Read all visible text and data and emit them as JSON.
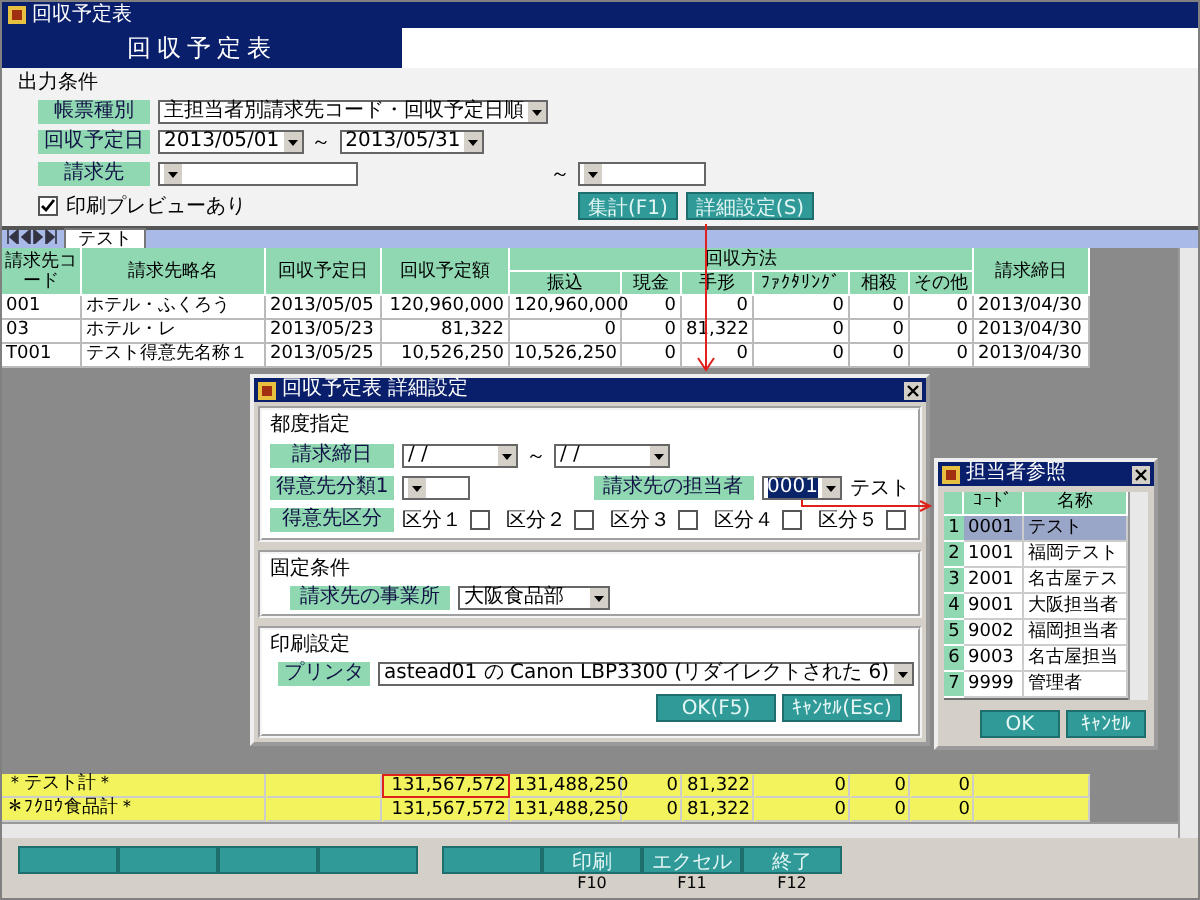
{
  "window": {
    "title": "回収予定表"
  },
  "header": {
    "title": "回収予定表"
  },
  "conditions": {
    "heading": "出力条件",
    "report_type": {
      "label": "帳票種別",
      "value": "主担当者別請求先コード・回収予定日順"
    },
    "due_date": {
      "label": "回収予定日",
      "from": "2013/05/01",
      "separator": "～",
      "to": "2013/05/31"
    },
    "customer": {
      "label": "請求先",
      "separator": "～"
    },
    "preview": {
      "label": "印刷プレビューあり",
      "checked": true
    },
    "buttons": [
      "集計(F1)",
      "詳細設定(S)"
    ]
  },
  "tabs": [
    {
      "label": "テスト",
      "selected": true
    }
  ],
  "table": {
    "column_groups": [
      {
        "label": "回収方法"
      }
    ],
    "columns": [
      {
        "label": "請求先コード",
        "grouped": false
      },
      {
        "label": "請求先略名",
        "grouped": false
      },
      {
        "label": "回収予定日",
        "grouped": false
      },
      {
        "label": "回収予定額",
        "grouped": false
      },
      {
        "label": "振込",
        "grouped": true
      },
      {
        "label": "現金",
        "grouped": true
      },
      {
        "label": "手形",
        "grouped": true
      },
      {
        "label": "ﾌｧｸﾀﾘﾝｸﾞ",
        "grouped": true
      },
      {
        "label": "相殺",
        "grouped": true
      },
      {
        "label": "その他",
        "grouped": true
      },
      {
        "label": "請求締日",
        "grouped": false
      }
    ],
    "rows": [
      {
        "cells": [
          "001",
          "ホテル・ふくろう",
          "2013/05/05",
          "120,960,000",
          "120,960,000",
          "0",
          "0",
          "0",
          "0",
          "0",
          "2013/04/30"
        ]
      },
      {
        "cells": [
          "03",
          "ホテル・レ",
          "2013/05/23",
          "81,322",
          "0",
          "0",
          "81,322",
          "0",
          "0",
          "0",
          "2013/04/30"
        ]
      },
      {
        "cells": [
          "T001",
          "テスト得意先名称１",
          "2013/05/25",
          "10,526,250",
          "10,526,250",
          "0",
          "0",
          "0",
          "0",
          "0",
          "2013/04/30"
        ]
      }
    ],
    "totals": [
      {
        "label": "＊テスト計＊",
        "values": [
          {
            "text": "131,567,572",
            "highlighted": true
          },
          {
            "text": "131,488,250",
            "highlighted": false
          },
          {
            "text": "0",
            "highlighted": false
          },
          {
            "text": "81,322",
            "highlighted": false
          },
          {
            "text": "0",
            "highlighted": false
          },
          {
            "text": "0",
            "highlighted": false
          },
          {
            "text": "0",
            "highlighted": false
          }
        ]
      },
      {
        "label": "＊ﾌｸﾛｳ食品計＊",
        "values": [
          {
            "text": "131,567,572",
            "highlighted": false
          },
          {
            "text": "131,488,250",
            "highlighted": false
          },
          {
            "text": "0",
            "highlighted": false
          },
          {
            "text": "81,322",
            "highlighted": false
          },
          {
            "text": "0",
            "highlighted": false
          },
          {
            "text": "0",
            "highlighted": false
          },
          {
            "text": "0",
            "highlighted": false
          }
        ]
      }
    ]
  },
  "function_keys": [
    [
      {
        "kind": "blank"
      },
      {
        "kind": "blank"
      },
      {
        "kind": "blank"
      },
      {
        "kind": "blank"
      }
    ],
    [
      {
        "kind": "blank"
      },
      {
        "kind": "labeled",
        "label": "印刷",
        "key": "F10"
      },
      {
        "kind": "labeled",
        "label": "エクセル",
        "key": "F11"
      },
      {
        "kind": "labeled",
        "label": "終了",
        "key": "F12"
      }
    ]
  ],
  "detail_dialog": {
    "title": "回収予定表 詳細設定",
    "each_time": {
      "heading": "都度指定",
      "closing_date": {
        "label": "請求締日",
        "from": "/ /",
        "separator": "～",
        "to": "/ /"
      },
      "category": {
        "label": "得意先分類1"
      },
      "manager": {
        "label": "請求先の担当者",
        "value": "0001",
        "name": "テスト"
      },
      "division": {
        "label": "得意先区分",
        "options": [
          {
            "label": "区分１",
            "checked": false
          },
          {
            "label": "区分２",
            "checked": false
          },
          {
            "label": "区分３",
            "checked": false
          },
          {
            "label": "区分４",
            "checked": false
          },
          {
            "label": "区分５",
            "checked": false
          }
        ]
      }
    },
    "fixed": {
      "heading": "固定条件",
      "office": {
        "label": "請求先の事業所",
        "value": "大阪食品部"
      }
    },
    "print": {
      "heading": "印刷設定",
      "printer": {
        "label": "プリンタ",
        "value": "astead01 の Canon LBP3300 (リダイレクトされた 6)"
      }
    },
    "buttons": [
      "OK(F5)",
      "ｷｬﾝｾﾙ(Esc)"
    ]
  },
  "staff_dialog": {
    "title": "担当者参照",
    "columns": [
      "ｺｰﾄﾞ",
      "名称"
    ],
    "rows": [
      {
        "number": "1",
        "code": "0001",
        "name": "テスト",
        "selected": true
      },
      {
        "number": "2",
        "code": "1001",
        "name": "福岡テスト",
        "selected": false
      },
      {
        "number": "3",
        "code": "2001",
        "name": "名古屋テス",
        "selected": false
      },
      {
        "number": "4",
        "code": "9001",
        "name": "大阪担当者",
        "selected": false
      },
      {
        "number": "5",
        "code": "9002",
        "name": "福岡担当者",
        "selected": false
      },
      {
        "number": "6",
        "code": "9003",
        "name": "名古屋担当",
        "selected": false
      },
      {
        "number": "7",
        "code": "9999",
        "name": "管理者",
        "selected": false
      }
    ],
    "buttons": [
      "OK",
      "ｷｬﾝｾﾙ"
    ]
  }
}
